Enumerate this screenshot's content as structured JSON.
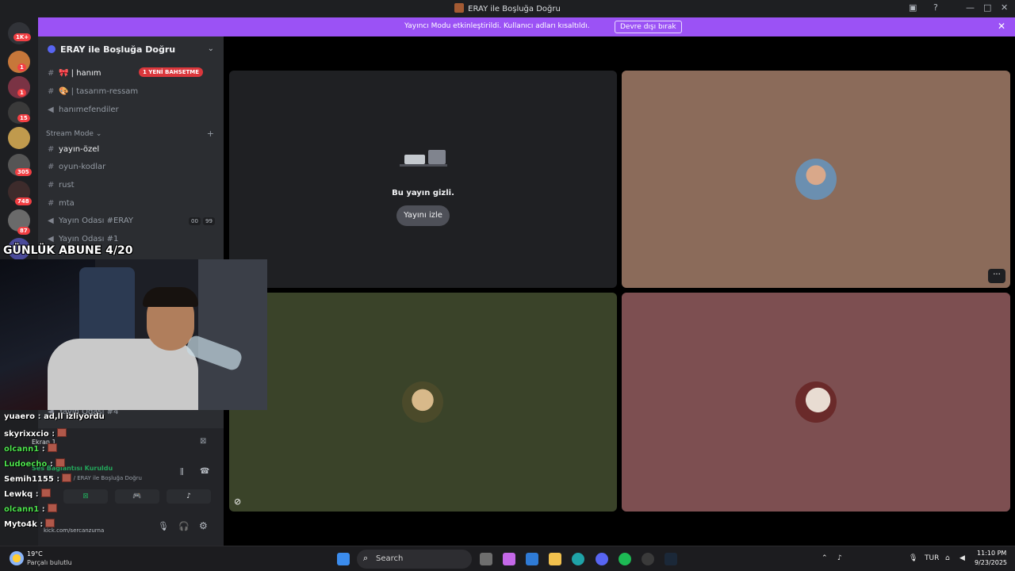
{
  "window": {
    "title": "ERAY ile Boşluğa Doğru"
  },
  "banner": {
    "message": "Yayıncı Modu etkinleştirildi. Kullanıcı adları kısaltıldı.",
    "button": "Devre dışı bırak"
  },
  "guilds": {
    "home_badge": "1K+",
    "badges": [
      "1",
      "1",
      "15",
      "305",
      "748",
      "87"
    ]
  },
  "sidebar": {
    "server_name": "ERAY ile Boşluğa Doğru",
    "channels_top": [
      {
        "name": "hanım",
        "type": "text"
      },
      {
        "name": "tasarım-ressam",
        "type": "text"
      },
      {
        "name": "hanımefendiler",
        "type": "voice"
      }
    ],
    "mention_badge": "1 YENİ BAHSETME",
    "category": "Stream Mode",
    "channels": [
      {
        "name": "yayın-özel",
        "type": "text"
      },
      {
        "name": "oyun-kodlar",
        "type": "text"
      },
      {
        "name": "rust",
        "type": "text"
      },
      {
        "name": "mta",
        "type": "text"
      },
      {
        "name": "Yayın Odası #ERAY",
        "type": "voice"
      },
      {
        "name": "Yayın Odası #1",
        "type": "voice"
      },
      {
        "name": "Yayın Odası #4",
        "type": "voice"
      }
    ],
    "voice_badges": [
      "00",
      "99"
    ]
  },
  "voice_panel": {
    "screen_label": "Ekran 1",
    "status": "Ses Bağlantısı Kuruldu",
    "location": "2 / ERAY ile Boşluğa Doğru",
    "user_link": "kick.com/sercanzurna"
  },
  "main": {
    "hidden_stream_text": "Bu yayın gizli.",
    "watch_button": "Yayını izle"
  },
  "overlay": {
    "title": "GÜNLÜK ABUNE 4/20",
    "chat": [
      {
        "user": "yuaero",
        "text": "ad,ll izliyordu",
        "color": "#ffffff"
      },
      {
        "user": "skyrixxcio",
        "text": "",
        "color": "#ffffff"
      },
      {
        "user": "olcann1",
        "text": "",
        "color": "#4ee34e"
      },
      {
        "user": "Ludoecho",
        "text": "",
        "color": "#4ee34e"
      },
      {
        "user": "Semih1155",
        "text": "",
        "color": "#ffffff"
      },
      {
        "user": "Lewkq",
        "text": "",
        "color": "#ffffff"
      },
      {
        "user": "olcann1",
        "text": "",
        "color": "#4ee34e"
      },
      {
        "user": "Myto4k",
        "text": "",
        "color": "#ffffff"
      }
    ]
  },
  "taskbar": {
    "weather_temp": "19°C",
    "weather_desc": "Parçalı bulutlu",
    "search_placeholder": "Search",
    "lang": "TUR",
    "time": "11:10 PM",
    "date": "9/23/2025"
  },
  "colors": {
    "accent": "#9b52f5",
    "tile_dark": "#1f2023",
    "tile_tan": "#8b6b5a",
    "tile_olive": "#3a4329",
    "tile_rose": "#7d4f51"
  }
}
